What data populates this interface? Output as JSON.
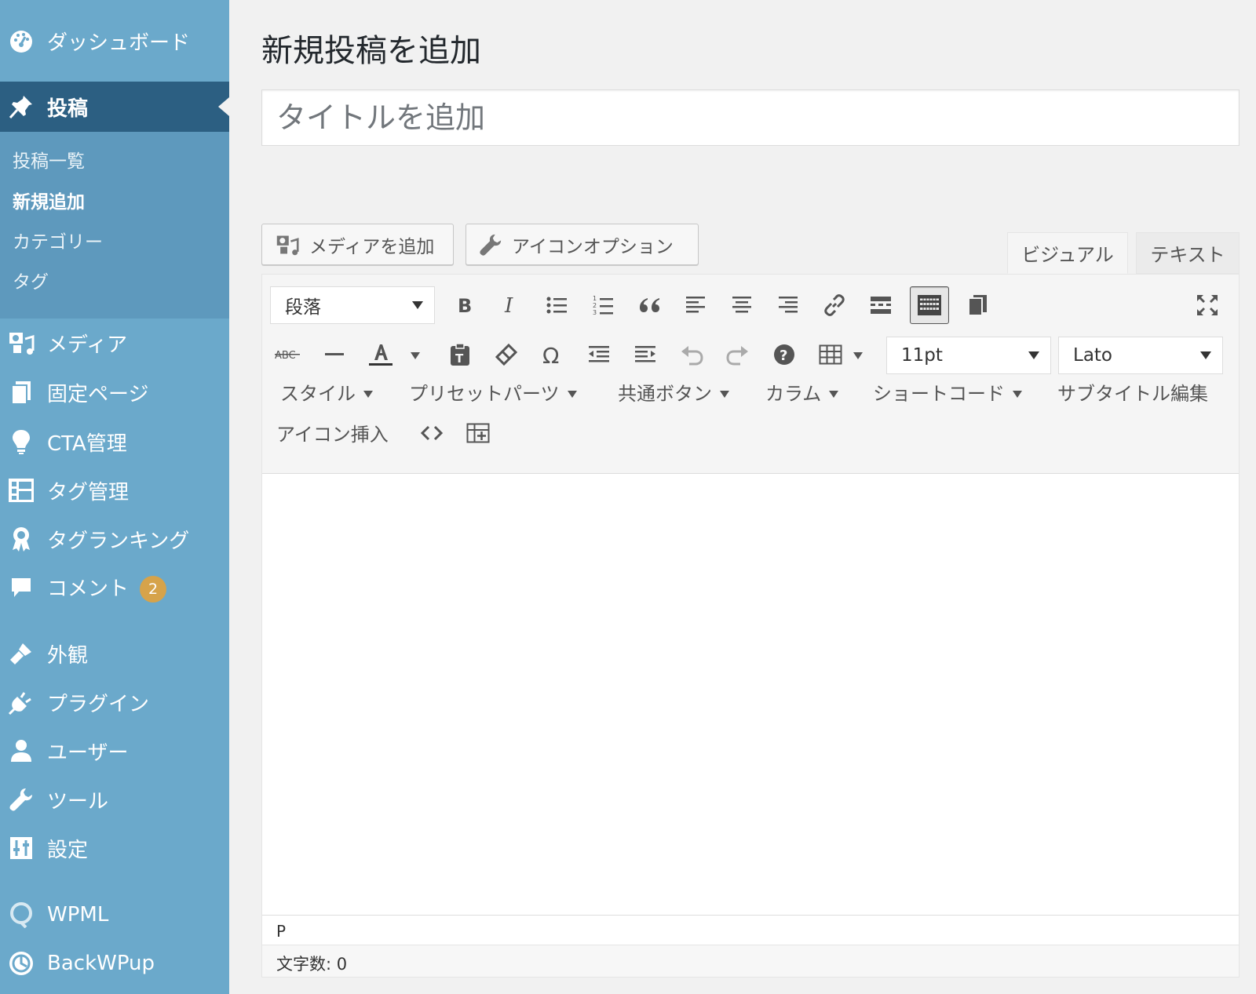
{
  "sidebar": {
    "dashboard": "ダッシュボード",
    "posts": "投稿",
    "submenu": [
      "投稿一覧",
      "新規追加",
      "カテゴリー",
      "タグ"
    ],
    "media": "メディア",
    "pages": "固定ページ",
    "cta": "CTA管理",
    "tag_manage": "タグ管理",
    "tag_ranking": "タグランキング",
    "comments": "コメント",
    "comments_count": "2",
    "appearance": "外観",
    "plugins": "プラグイン",
    "users": "ユーザー",
    "tools": "ツール",
    "settings": "設定",
    "wpml": "WPML",
    "backwpup": "BackWPup"
  },
  "main": {
    "page_title": "新規投稿を追加",
    "title_placeholder": "タイトルを追加",
    "add_media": "メディアを追加",
    "icon_options": "アイコンオプション",
    "tab_visual": "ビジュアル",
    "tab_text": "テキスト"
  },
  "toolbar": {
    "format_select": "段落",
    "font_size": "11pt",
    "font_family": "Lato",
    "strike_label": "ABC",
    "menus": [
      "スタイル",
      "プリセットパーツ",
      "共通ボタン",
      "カラム",
      "ショートコード",
      "サブタイトル編集"
    ],
    "icon_insert": "アイコン挿入"
  },
  "status": {
    "path": "P",
    "word_count": "文字数: 0"
  },
  "colors": {
    "sidebar_bg": "#6ba9cb",
    "sidebar_active": "#2c5f82",
    "submenu_bg": "#5e99bd",
    "badge": "#d6a34a"
  }
}
